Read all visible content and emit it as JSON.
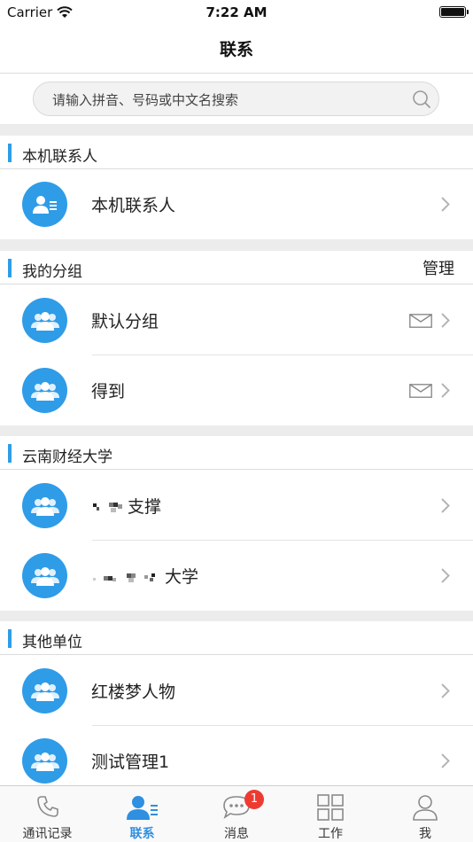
{
  "status_bar": {
    "carrier": "Carrier",
    "time": "7:22 AM"
  },
  "nav": {
    "title": "联系"
  },
  "search": {
    "placeholder": "请输入拼音、号码或中文名搜索"
  },
  "sections": [
    {
      "title": "本机联系人",
      "action": "",
      "items": [
        {
          "name": "本机联系人",
          "icon": "contact-card-icon",
          "mail": false
        }
      ]
    },
    {
      "title": "我的分组",
      "action": "管理",
      "items": [
        {
          "name": "默认分组",
          "icon": "group-icon",
          "mail": true
        },
        {
          "name": "得到",
          "icon": "group-icon",
          "mail": true
        }
      ]
    },
    {
      "title": "云南财经大学",
      "action": "",
      "items": [
        {
          "name": "支撑",
          "icon": "group-icon",
          "mail": false,
          "redacted_prefix": true
        },
        {
          "name": "大学",
          "icon": "group-icon",
          "mail": false,
          "redacted_prefix": true
        }
      ]
    },
    {
      "title": "其他单位",
      "action": "",
      "items": [
        {
          "name": "红楼梦人物",
          "icon": "group-icon",
          "mail": false
        },
        {
          "name": "测试管理1",
          "icon": "group-icon",
          "mail": false
        }
      ]
    }
  ],
  "tabs": [
    {
      "label": "通讯记录",
      "icon": "phone-icon",
      "active": false
    },
    {
      "label": "联系",
      "icon": "contacts-icon",
      "active": true
    },
    {
      "label": "消息",
      "icon": "chat-bubble-icon",
      "active": false,
      "badge": "1"
    },
    {
      "label": "工作",
      "icon": "grid-icon",
      "active": false
    },
    {
      "label": "我",
      "icon": "person-icon",
      "active": false
    }
  ],
  "colors": {
    "accent": "#2f9ce8",
    "badge": "#ee3b32",
    "background_gap": "#ececec"
  }
}
